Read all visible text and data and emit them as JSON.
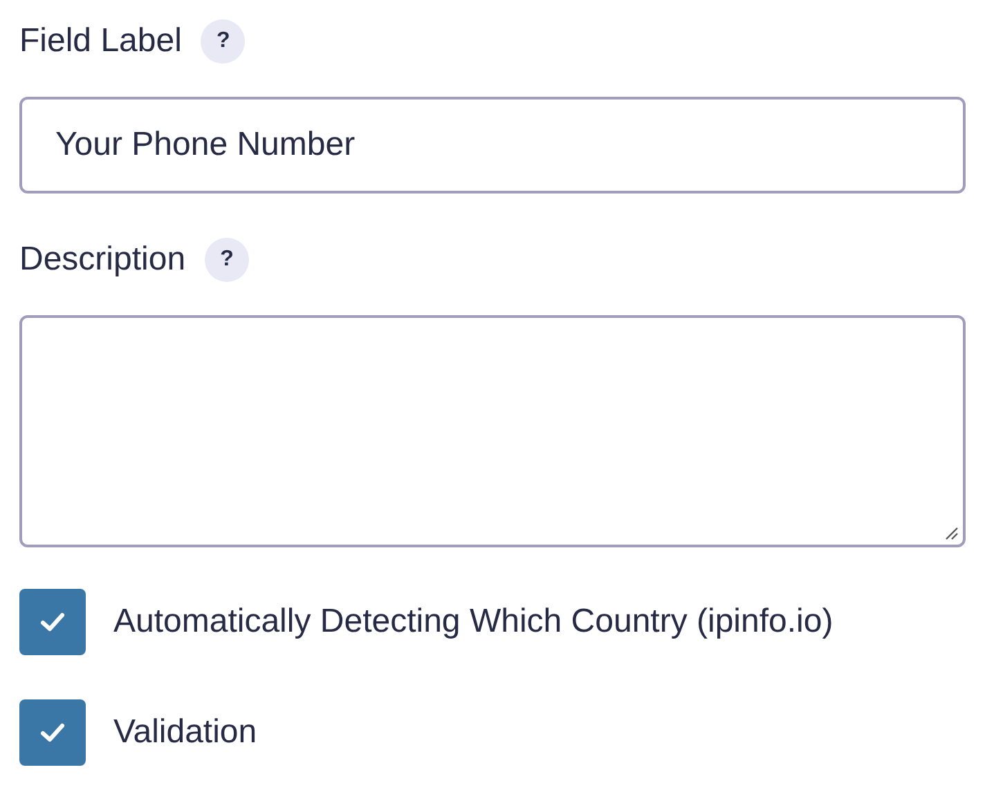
{
  "fields": [
    {
      "kind": "text",
      "label": "Field Label",
      "help": "?",
      "value": "Your Phone Number"
    },
    {
      "kind": "textarea",
      "label": "Description",
      "help": "?"
    }
  ],
  "options": [
    {
      "label": "Automatically Detecting Which Country (ipinfo.io)",
      "checked": true
    },
    {
      "label": "Validation",
      "checked": true
    }
  ]
}
